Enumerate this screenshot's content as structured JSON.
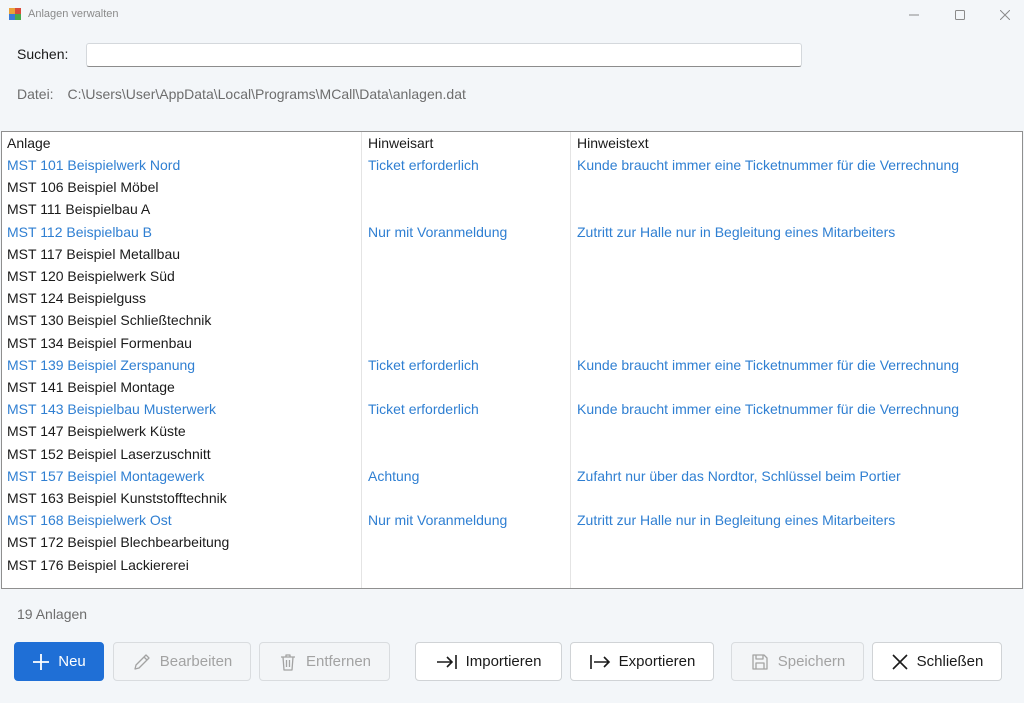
{
  "window": {
    "title": "Anlagen verwalten"
  },
  "search": {
    "label": "Suchen:",
    "value": "",
    "placeholder": ""
  },
  "file": {
    "label": "Datei:",
    "path": "C:\\Users\\User\\AppData\\Local\\Programs\\MCall\\Data\\anlagen.dat"
  },
  "grid": {
    "columns": [
      "Anlage",
      "Hinweisart",
      "Hinweistext"
    ],
    "rows": [
      {
        "anlage": "MST 101 Beispielwerk Nord",
        "hinweisart": "Ticket erforderlich",
        "hinweistext": "Kunde braucht immer eine Ticketnummer für die Verrechnung"
      },
      {
        "anlage": "MST 106 Beispiel Möbel",
        "hinweisart": "",
        "hinweistext": ""
      },
      {
        "anlage": "MST 111 Beispielbau A",
        "hinweisart": "",
        "hinweistext": ""
      },
      {
        "anlage": "MST 112 Beispielbau B",
        "hinweisart": "Nur mit Voranmeldung",
        "hinweistext": "Zutritt zur Halle nur in Begleitung eines Mitarbeiters"
      },
      {
        "anlage": "MST 117 Beispiel Metallbau",
        "hinweisart": "",
        "hinweistext": ""
      },
      {
        "anlage": "MST 120 Beispielwerk Süd",
        "hinweisart": "",
        "hinweistext": ""
      },
      {
        "anlage": "MST 124 Beispielguss",
        "hinweisart": "",
        "hinweistext": ""
      },
      {
        "anlage": "MST 130 Beispiel Schließtechnik",
        "hinweisart": "",
        "hinweistext": ""
      },
      {
        "anlage": "MST 134 Beispiel Formenbau",
        "hinweisart": "",
        "hinweistext": ""
      },
      {
        "anlage": "MST 139 Beispiel Zerspanung",
        "hinweisart": "Ticket erforderlich",
        "hinweistext": "Kunde braucht immer eine Ticketnummer für die Verrechnung"
      },
      {
        "anlage": "MST 141 Beispiel Montage",
        "hinweisart": "",
        "hinweistext": ""
      },
      {
        "anlage": "MST 143 Beispielbau Musterwerk",
        "hinweisart": "Ticket erforderlich",
        "hinweistext": "Kunde braucht immer eine Ticketnummer für die Verrechnung"
      },
      {
        "anlage": "MST 147 Beispielwerk Küste",
        "hinweisart": "",
        "hinweistext": ""
      },
      {
        "anlage": "MST 152 Beispiel Laserzuschnitt",
        "hinweisart": "",
        "hinweistext": ""
      },
      {
        "anlage": "MST 157 Beispiel Montagewerk",
        "hinweisart": "Achtung",
        "hinweistext": "Zufahrt nur über das Nordtor, Schlüssel beim Portier"
      },
      {
        "anlage": "MST 163 Beispiel Kunststofftechnik",
        "hinweisart": "",
        "hinweistext": ""
      },
      {
        "anlage": "MST 168 Beispielwerk Ost",
        "hinweisart": "Nur mit Voranmeldung",
        "hinweistext": "Zutritt zur Halle nur in Begleitung eines Mitarbeiters"
      },
      {
        "anlage": "MST 172 Beispiel Blechbearbeitung",
        "hinweisart": "",
        "hinweistext": ""
      },
      {
        "anlage": "MST 176 Beispiel Lackiererei",
        "hinweisart": "",
        "hinweistext": ""
      }
    ]
  },
  "footer": {
    "count_text": "19 Anlagen"
  },
  "buttons": {
    "new": {
      "label": "Neu",
      "icon": "plus-icon",
      "enabled": true
    },
    "edit": {
      "label": "Bearbeiten",
      "icon": "pencil-icon",
      "enabled": false
    },
    "remove": {
      "label": "Entfernen",
      "icon": "trash-icon",
      "enabled": false
    },
    "import": {
      "label": "Importieren",
      "icon": "import-arrow-icon",
      "enabled": true
    },
    "export": {
      "label": "Exportieren",
      "icon": "export-arrow-icon",
      "enabled": true
    },
    "save": {
      "label": "Speichern",
      "icon": "save-icon",
      "enabled": false
    },
    "close": {
      "label": "Schließen",
      "icon": "close-x-icon",
      "enabled": true
    }
  },
  "colors": {
    "accent": "#1f6fd6",
    "note_text": "#2f7fd2",
    "background": "#f3f6f9"
  }
}
